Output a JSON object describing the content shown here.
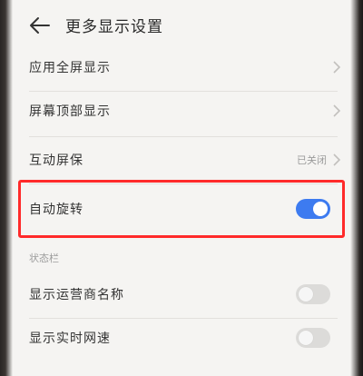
{
  "header": {
    "title": "更多显示设置"
  },
  "items": {
    "fullscreen": {
      "label": "应用全屏显示"
    },
    "top_display": {
      "label": "屏幕顶部显示"
    },
    "screensaver": {
      "label": "互动屏保",
      "value": "已关闭"
    },
    "auto_rotate": {
      "label": "自动旋转",
      "enabled": true
    }
  },
  "status_bar": {
    "section_title": "状态栏",
    "carrier_name": {
      "label": "显示运营商名称",
      "enabled": false
    },
    "network_speed": {
      "label": "显示实时网速",
      "enabled": false
    }
  },
  "colors": {
    "accent": "#3d7bf0",
    "highlight": "#ff2a2a",
    "toggle_off": "#dcdbd9"
  },
  "icons": {
    "back": "arrow-left-icon",
    "chevron": "chevron-right-icon"
  }
}
